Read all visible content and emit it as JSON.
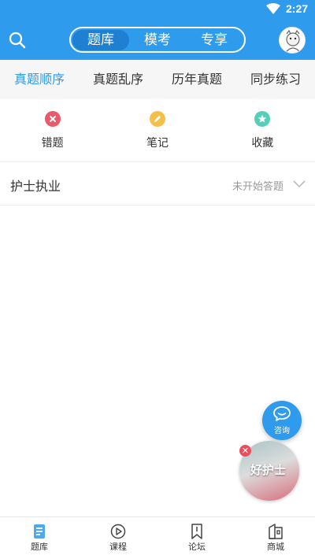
{
  "status_bar": {
    "time": "2:27"
  },
  "header": {
    "segments": [
      {
        "label": "题库",
        "selected": true
      },
      {
        "label": "模考",
        "selected": false
      },
      {
        "label": "专享",
        "selected": false
      }
    ]
  },
  "tabs": [
    {
      "label": "真题顺序",
      "active": true
    },
    {
      "label": "真题乱序",
      "active": false
    },
    {
      "label": "历年真题",
      "active": false
    },
    {
      "label": "同步练习",
      "active": false
    }
  ],
  "quick_actions": [
    {
      "label": "错题",
      "icon": "close-circle-icon",
      "color": "#ea5a6a"
    },
    {
      "label": "笔记",
      "icon": "pencil-icon",
      "color": "#f5c04a"
    },
    {
      "label": "收藏",
      "icon": "star-icon",
      "color": "#56cfb9"
    }
  ],
  "subject_row": {
    "title": "护士执业",
    "status": "未开始答题"
  },
  "float": {
    "consult_label": "咨询",
    "promo_text": "好护士"
  },
  "bottom_nav": [
    {
      "label": "题库",
      "icon": "book-icon",
      "active": true
    },
    {
      "label": "课程",
      "icon": "play-icon",
      "active": false
    },
    {
      "label": "论坛",
      "icon": "bookmark-icon",
      "active": false
    },
    {
      "label": "商城",
      "icon": "store-icon",
      "active": false
    }
  ],
  "colors": {
    "primary": "#2f9bec",
    "tab_bg": "#f6f6f6"
  }
}
